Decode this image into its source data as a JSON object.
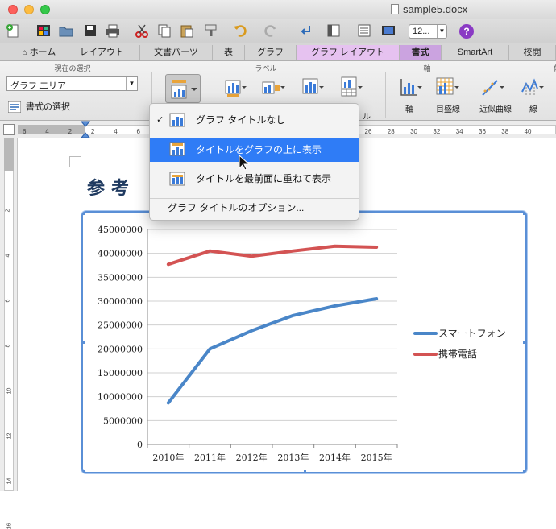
{
  "window": {
    "title": "sample5.docx"
  },
  "toolbar": {
    "zoom_value": "12...",
    "help_label": "?"
  },
  "tabs": [
    {
      "label": "ホーム"
    },
    {
      "label": "レイアウト"
    },
    {
      "label": "文書パーツ"
    },
    {
      "label": "表"
    },
    {
      "label": "グラフ"
    },
    {
      "label": "グラフ レイアウト"
    },
    {
      "label": "書式"
    },
    {
      "label": "SmartArt"
    },
    {
      "label": "校閲"
    }
  ],
  "ribbon": {
    "current_selection_title": "現在の選択",
    "selection_value": "グラフ エリア",
    "format_selection_label": "書式の選択",
    "labels_group_title": "ラベル",
    "axes_group_title": "軸",
    "analysis_group_title": "解",
    "axis_label": "軸",
    "gridlines_label": "目盛線",
    "trendline_label": "近似曲線",
    "lines_label": "線",
    "partial_label_1": "ータ",
    "partial_label_2": "ータ",
    "partial_label_3": "ル"
  },
  "ruler_numbers": [
    "6",
    "4",
    "2",
    "2",
    "4",
    "6",
    "8",
    "10",
    "12",
    "14",
    "16",
    "18",
    "20",
    "22",
    "24",
    "26",
    "28",
    "30",
    "32",
    "34",
    "36",
    "38",
    "40"
  ],
  "vruler_numbers": [
    "2",
    "4",
    "6",
    "8",
    "10",
    "12",
    "14",
    "16"
  ],
  "document": {
    "heading": "参考"
  },
  "menu": {
    "checkmark": "✓",
    "items": [
      {
        "label": "グラフ タイトルなし"
      },
      {
        "label": "タイトルをグラフの上に表示"
      },
      {
        "label": "タイトルを最前面に重ねて表示"
      }
    ],
    "options_label": "グラフ タイトルのオプション..."
  },
  "chart_data": {
    "type": "line",
    "categories": [
      "2010年",
      "2011年",
      "2012年",
      "2013年",
      "2014年",
      "2015年"
    ],
    "series": [
      {
        "name": "スマートフォン",
        "values": [
          8700000,
          20000000,
          23800000,
          27000000,
          29000000,
          30500000
        ],
        "color": "#4a86c8"
      },
      {
        "name": "携帯電話",
        "values": [
          37700000,
          40500000,
          39400000,
          40500000,
          41500000,
          41300000
        ],
        "color": "#d35353"
      }
    ],
    "ylim": [
      0,
      45000000
    ],
    "yticks": [
      0,
      5000000,
      10000000,
      15000000,
      20000000,
      25000000,
      30000000,
      35000000,
      40000000,
      45000000
    ],
    "grid": true,
    "legend": "right",
    "title": "",
    "xlabel": "",
    "ylabel": ""
  }
}
